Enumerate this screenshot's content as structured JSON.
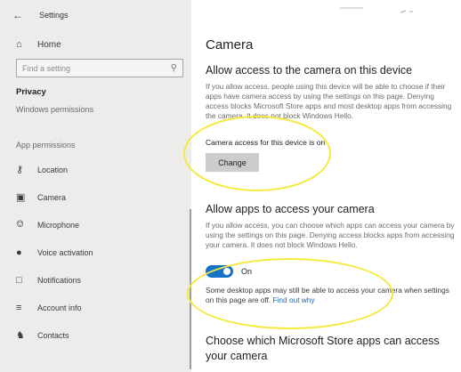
{
  "window": {
    "title": "Settings"
  },
  "nav": {
    "home_label": "Home",
    "search_placeholder": "Find a setting",
    "section_title": "Privacy",
    "windows_permissions_label": "Windows permissions",
    "app_permissions_label": "App permissions",
    "items": [
      {
        "label": "Location",
        "icon": "location-icon"
      },
      {
        "label": "Camera",
        "icon": "camera-icon"
      },
      {
        "label": "Microphone",
        "icon": "microphone-icon"
      },
      {
        "label": "Voice activation",
        "icon": "voice-activation-icon"
      },
      {
        "label": "Notifications",
        "icon": "notifications-icon"
      },
      {
        "label": "Account info",
        "icon": "account-info-icon"
      },
      {
        "label": "Contacts",
        "icon": "contacts-icon"
      }
    ]
  },
  "main": {
    "page_title": "Camera",
    "device_section": {
      "heading": "Allow access to the camera on this device",
      "description": "If you allow access, people using this device will be able to choose if their apps have camera access by using the settings on this page. Denying access blocks Microsoft Store apps and most desktop apps from accessing the camera. It does not block Windows Hello.",
      "status": "Camera access for this device is on",
      "change_label": "Change"
    },
    "apps_section": {
      "heading": "Allow apps to access your camera",
      "description": "If you allow access, you can choose which apps can access your camera by using the settings on this page. Denying access blocks apps from accessing your camera. It does not block Windows Hello.",
      "toggle_label": "On",
      "toggle_on": true,
      "note": "Some desktop apps may still be able to access your camera when settings on this page are off.",
      "link": "Find out why"
    },
    "store_section": {
      "heading": "Choose which Microsoft Store apps can access your camera"
    }
  },
  "colors": {
    "accent": "#1472c7",
    "annotation": "#f4ea3e",
    "nav_background": "#eeeceb"
  }
}
